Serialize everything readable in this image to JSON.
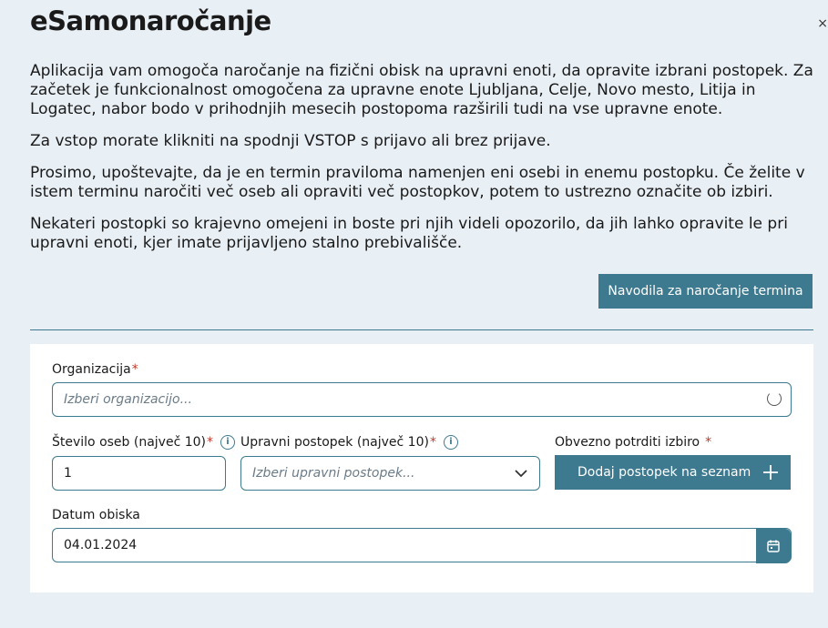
{
  "page": {
    "title": "eSamonaročanje",
    "close_glyph": "×"
  },
  "intro": {
    "paragraphs": [
      "Aplikacija vam omogoča naročanje na fizični obisk na upravni enoti, da opravite izbrani postopek. Za začetek je funkcionalnost omogočena za upravne enote Ljubljana, Celje, Novo mesto, Litija in Logatec, nabor bodo v prihodnjih mesecih postopoma razširili tudi na vse upravne enote.",
      "Za vstop morate klikniti na spodnji VSTOP s prijavo ali brez prijave.",
      "Prosimo, upoštevajte, da je en termin praviloma namenjen eni osebi in enemu postopku. Če želite v istem terminu naročiti več oseb ali opraviti več postopkov, potem to ustrezno označite ob izbiri.",
      "Nekateri postopki so krajevno omejeni in boste pri njih videli opozorilo, da jih lahko opravite le pri upravni enoti, kjer imate prijavljeno stalno prebivališče."
    ]
  },
  "help_button": {
    "label": "Navodila za naročanje termina"
  },
  "form": {
    "organization": {
      "label": "Organizacija",
      "required_mark": "*",
      "placeholder": "Izberi organizacijo..."
    },
    "persons": {
      "label": "Število oseb (največ 10)",
      "required_mark": "*",
      "info": "i",
      "value": "1"
    },
    "procedure": {
      "label": "Upravni postopek (največ 10)",
      "required_mark": "*",
      "info": "i",
      "placeholder": "Izberi upravni postopek..."
    },
    "confirm": {
      "label": "Obvezno potrditi izbiro",
      "required_mark": "*",
      "button_label": "Dodaj postopek na seznam"
    },
    "date": {
      "label": "Datum obiska",
      "value": "04.01.2024"
    }
  },
  "icons": {
    "spinner": "loading-spinner-icon",
    "chevron": "chevron-down-icon",
    "plus": "plus-icon",
    "calendar": "calendar-icon",
    "info": "info-icon"
  },
  "colors": {
    "accent": "#3e7a8f",
    "background": "#e8eff5",
    "required": "#c0392b"
  }
}
